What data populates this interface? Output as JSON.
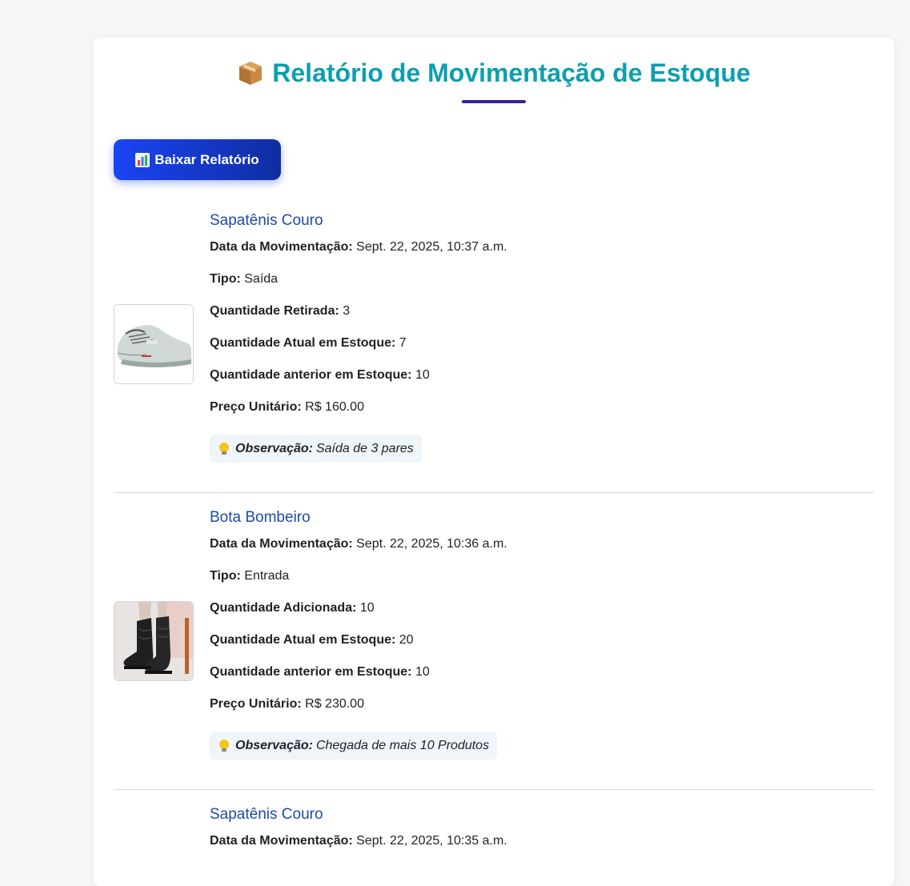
{
  "header": {
    "title": "Relatório de Movimentação de Estoque",
    "title_icon": "package-icon"
  },
  "toolbar": {
    "download_label": "Baixar Relatório",
    "download_icon": "bar-chart-icon"
  },
  "labels": {
    "date": "Data da Movimentação:",
    "type": "Tipo:",
    "qty_removed": "Quantidade Retirada:",
    "qty_added": "Quantidade Adicionada:",
    "qty_current": "Quantidade Atual em Estoque:",
    "qty_previous": "Quantidade anterior em Estoque:",
    "unit_price": "Preço Unitário:",
    "observation": "Observação:"
  },
  "movements": [
    {
      "product": "Sapatênis Couro",
      "date": "Sept. 22, 2025, 10:37 a.m.",
      "type": "Saída",
      "qty_label_key": "qty_removed",
      "qty_label": "Quantidade Retirada:",
      "qty": "3",
      "current_stock": "7",
      "previous_stock": "10",
      "unit_price": "R$ 160.00",
      "observation": "Saída de 3 pares",
      "image": "sneaker-photo"
    },
    {
      "product": "Bota Bombeiro",
      "date": "Sept. 22, 2025, 10:36 a.m.",
      "type": "Entrada",
      "qty_label_key": "qty_added",
      "qty_label": "Quantidade Adicionada:",
      "qty": "10",
      "current_stock": "20",
      "previous_stock": "10",
      "unit_price": "R$ 230.00",
      "observation": "Chegada de mais 10 Produtos",
      "image": "boot-photo"
    },
    {
      "product": "Sapatênis Couro",
      "date": "Sept. 22, 2025, 10:35 a.m."
    }
  ],
  "colors": {
    "title": "#0b9fb0",
    "accent_underline": "#3b1fa6",
    "button": "#1a44f4",
    "product_name": "#1e4aa8",
    "observation_bg": "#eef6fc"
  }
}
